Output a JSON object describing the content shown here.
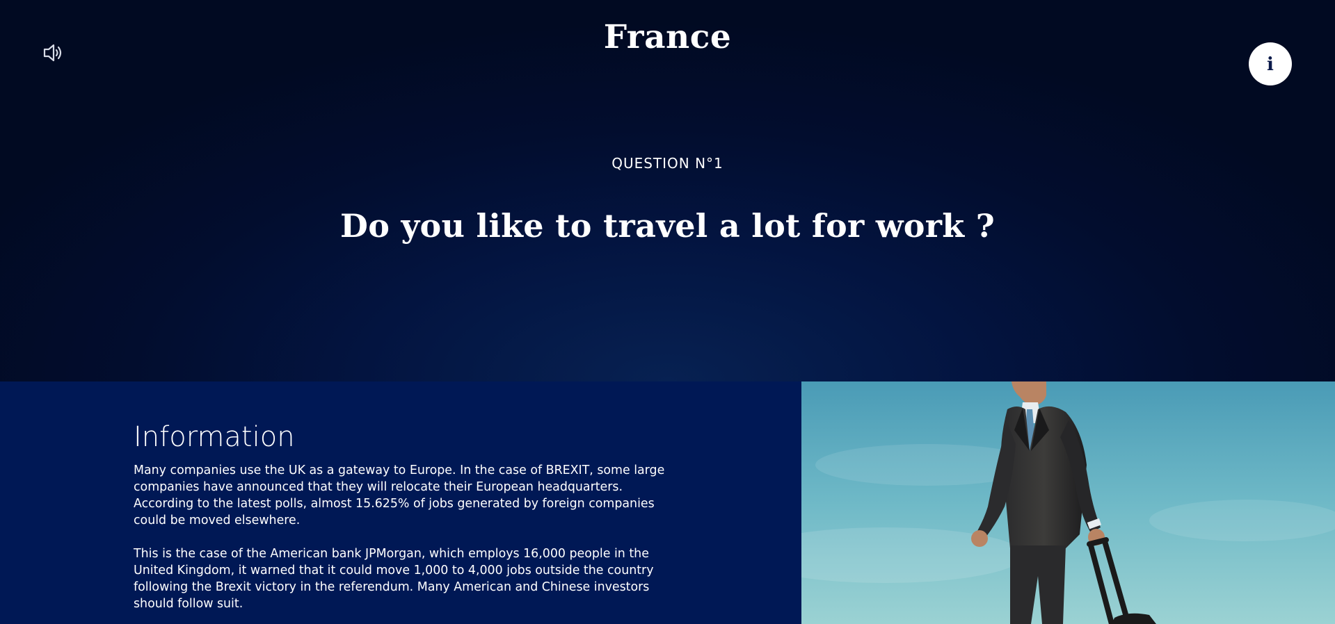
{
  "header": {
    "title": "France",
    "sound_icon": "speaker-volume-icon",
    "info_icon": "info-icon",
    "info_glyph": "i"
  },
  "question": {
    "number_label": "QUESTION N°1",
    "text": "Do you like to travel a lot for work ?"
  },
  "information": {
    "heading": "Information",
    "paragraphs": [
      "Many companies use the UK as a gateway to Europe. In the case of BREXIT, some large companies have announced that they will relocate their European headquarters. According to the latest polls, almost 15.625% of jobs generated by foreign companies could be moved elsewhere.",
      "This is the case of the American bank JPMorgan, which employs 16,000 people in the United Kingdom, it warned that it could move 1,000 to 4,000 jobs outside the country following the Brexit victory in the referendum. Many American and Chinese investors should follow suit."
    ]
  },
  "photo": {
    "subject": "businessman-with-suitcase-image"
  },
  "colors": {
    "hero_dark": "#010a22",
    "hero_glow": "#072152",
    "info_panel": "#001855",
    "text": "#ffffff",
    "sky": "#6cb7c6"
  }
}
